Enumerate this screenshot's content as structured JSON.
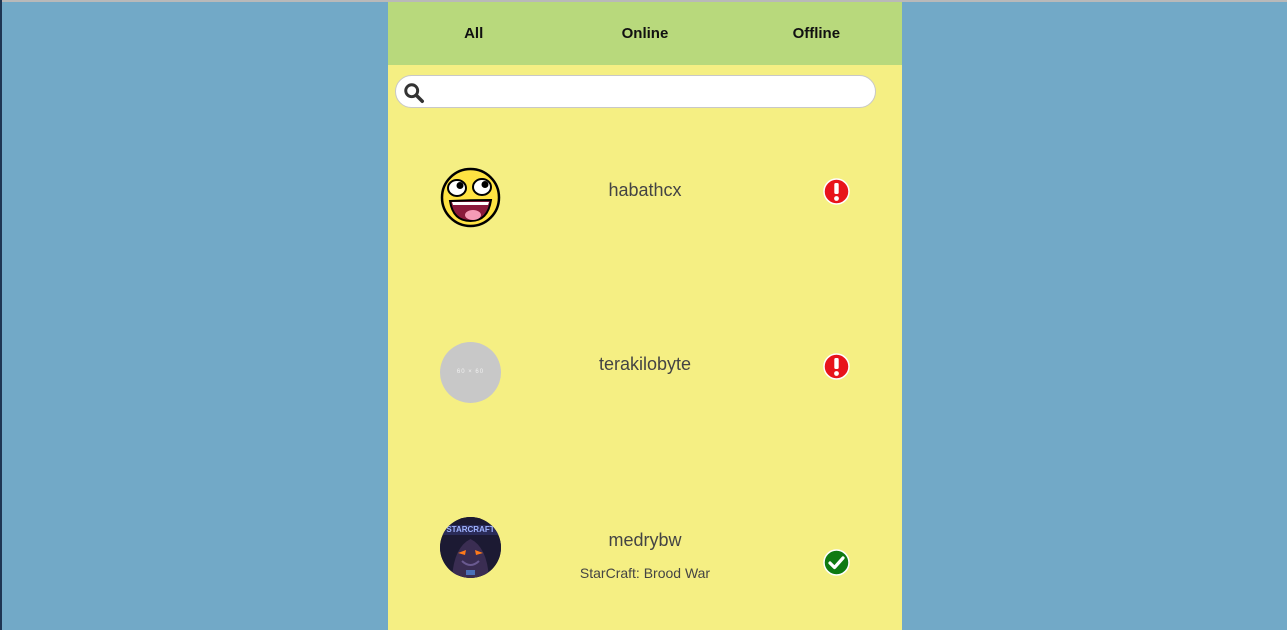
{
  "tabs": [
    "All",
    "Online",
    "Offline"
  ],
  "search": {
    "placeholder": ""
  },
  "users": [
    {
      "name": "habathcx",
      "game": "",
      "status": "offline"
    },
    {
      "name": "terakilobyte",
      "game": "",
      "status": "offline",
      "avatar_text": "60 × 60"
    },
    {
      "name": "medrybw",
      "game": "StarCraft: Brood War",
      "status": "online"
    }
  ],
  "colors": {
    "page_bg": "#72a9c7",
    "panel_bg": "#f5ef83",
    "tabs_bg": "#b8d97c",
    "offline": "#e8141b",
    "online": "#0f7a12"
  }
}
